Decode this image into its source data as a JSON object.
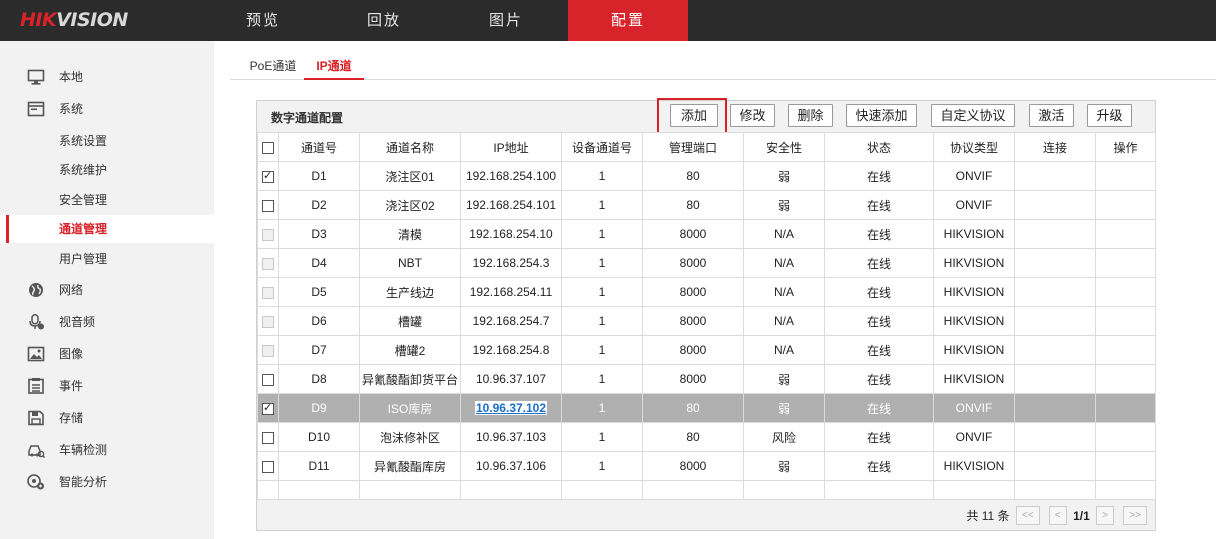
{
  "header": {
    "logo_red": "HIK",
    "logo_grey": "VISION",
    "nav": [
      {
        "label": "预览"
      },
      {
        "label": "回放"
      },
      {
        "label": "图片"
      },
      {
        "label": "配置"
      }
    ],
    "active_nav": "配置",
    "accent_color": "#d8232a"
  },
  "sidebar": {
    "items": [
      {
        "label": "本地",
        "icon": "monitor-icon"
      },
      {
        "label": "系统",
        "icon": "system-window-icon"
      },
      {
        "label": "系统设置"
      },
      {
        "label": "系统维护"
      },
      {
        "label": "安全管理"
      },
      {
        "label": "通道管理"
      },
      {
        "label": "用户管理"
      },
      {
        "label": "网络",
        "icon": "globe-icon"
      },
      {
        "label": "视音频",
        "icon": "microphone-icon"
      },
      {
        "label": "图像",
        "icon": "image-icon"
      },
      {
        "label": "事件",
        "icon": "list-icon"
      },
      {
        "label": "存储",
        "icon": "save-icon"
      },
      {
        "label": "车辆检测",
        "icon": "vehicle-icon"
      },
      {
        "label": "智能分析",
        "icon": "analysis-icon"
      }
    ],
    "active": "通道管理"
  },
  "tabs": [
    {
      "label": "PoE通道"
    },
    {
      "label": "IP通道"
    }
  ],
  "active_tab": "IP通道",
  "panel": {
    "title": "数字通道配置",
    "buttons": [
      "添加",
      "修改",
      "删除",
      "快速添加",
      "自定义协议",
      "激活",
      "升级"
    ]
  },
  "table": {
    "columns": [
      "通道号",
      "通道名称",
      "IP地址",
      "设备通道号",
      "管理端口",
      "安全性",
      "状态",
      "协议类型",
      "连接",
      "操作"
    ],
    "rows": [
      {
        "checkbox": "checked",
        "cells": [
          "D1",
          "浇注区01",
          "192.168.254.100",
          "1",
          "80",
          "弱",
          "在线",
          "ONVIF",
          "",
          ""
        ]
      },
      {
        "checkbox": "unchecked",
        "cells": [
          "D2",
          "浇注区02",
          "192.168.254.101",
          "1",
          "80",
          "弱",
          "在线",
          "ONVIF",
          "",
          ""
        ]
      },
      {
        "checkbox": "disabled",
        "cells": [
          "D3",
          "清模",
          "192.168.254.10",
          "1",
          "8000",
          "N/A",
          "在线",
          "HIKVISION",
          "",
          ""
        ]
      },
      {
        "checkbox": "disabled",
        "cells": [
          "D4",
          "NBT",
          "192.168.254.3",
          "1",
          "8000",
          "N/A",
          "在线",
          "HIKVISION",
          "",
          ""
        ]
      },
      {
        "checkbox": "disabled",
        "cells": [
          "D5",
          "生产线边",
          "192.168.254.11",
          "1",
          "8000",
          "N/A",
          "在线",
          "HIKVISION",
          "",
          ""
        ]
      },
      {
        "checkbox": "disabled",
        "cells": [
          "D6",
          "槽罐",
          "192.168.254.7",
          "1",
          "8000",
          "N/A",
          "在线",
          "HIKVISION",
          "",
          ""
        ]
      },
      {
        "checkbox": "disabled",
        "cells": [
          "D7",
          "槽罐2",
          "192.168.254.8",
          "1",
          "8000",
          "N/A",
          "在线",
          "HIKVISION",
          "",
          ""
        ]
      },
      {
        "checkbox": "unchecked",
        "cells": [
          "D8",
          "异氰酸酯卸货平台",
          "10.96.37.107",
          "1",
          "8000",
          "弱",
          "在线",
          "HIKVISION",
          "",
          ""
        ]
      },
      {
        "checkbox": "checked",
        "selected": true,
        "cells": [
          "D9",
          "ISO库房",
          "10.96.37.102",
          "1",
          "80",
          "弱",
          "在线",
          "ONVIF",
          "",
          ""
        ]
      },
      {
        "checkbox": "unchecked",
        "cells": [
          "D10",
          "泡沫修补区",
          "10.96.37.103",
          "1",
          "80",
          "风险",
          "在线",
          "ONVIF",
          "",
          ""
        ]
      },
      {
        "checkbox": "unchecked",
        "cells": [
          "D11",
          "异氰酸酯库房",
          "10.96.37.106",
          "1",
          "8000",
          "弱",
          "在线",
          "HIKVISION",
          "",
          ""
        ]
      }
    ]
  },
  "pager": {
    "total": "共 11 条",
    "first": "<<",
    "prev": "<",
    "page": "1/1",
    "next": ">",
    "last": ">>"
  }
}
